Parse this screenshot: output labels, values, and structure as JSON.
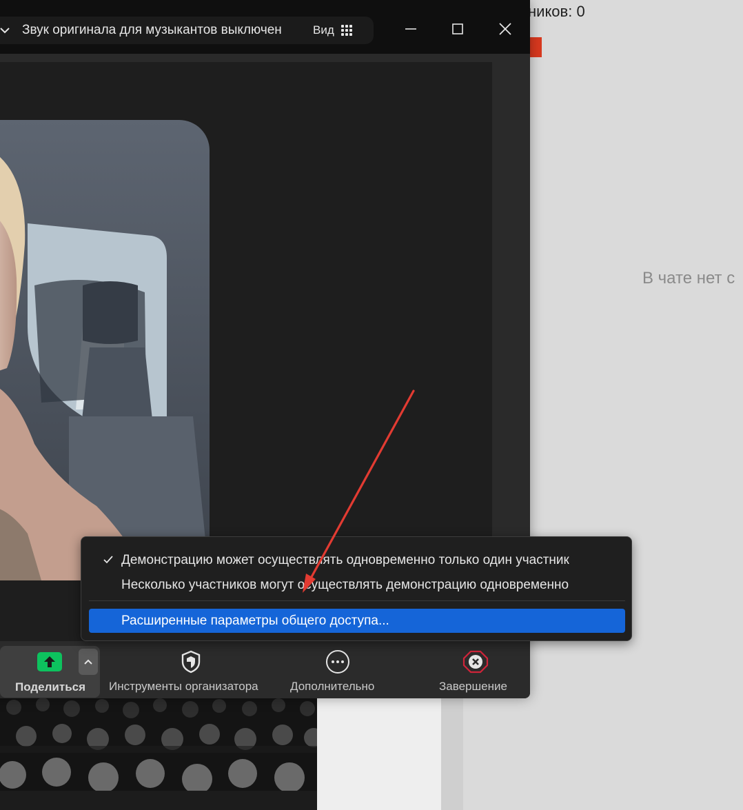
{
  "background": {
    "participants_label": "ников: 0",
    "chat_empty_text": "В чате нет с"
  },
  "window": {
    "status_text": "Звук оригинала для музыкантов выключен",
    "view_label": "Вид"
  },
  "toolbar": {
    "share_label": "Поделиться",
    "host_tools_label": "Инструменты организатора",
    "more_label": "Дополнительно",
    "end_label": "Завершение"
  },
  "share_menu": {
    "items": [
      {
        "label": "Демонстрацию может осуществлять одновременно только один участник",
        "checked": true
      },
      {
        "label": "Несколько участников могут осуществлять демонстрацию одновременно",
        "checked": false
      },
      {
        "label": "Расширенные параметры общего доступа...",
        "highlighted": true
      }
    ]
  },
  "colors": {
    "share_green": "#0dc25e",
    "highlight_blue": "#1565d8",
    "end_red": "#d0243a",
    "annotation_arrow": "#e23b32"
  }
}
